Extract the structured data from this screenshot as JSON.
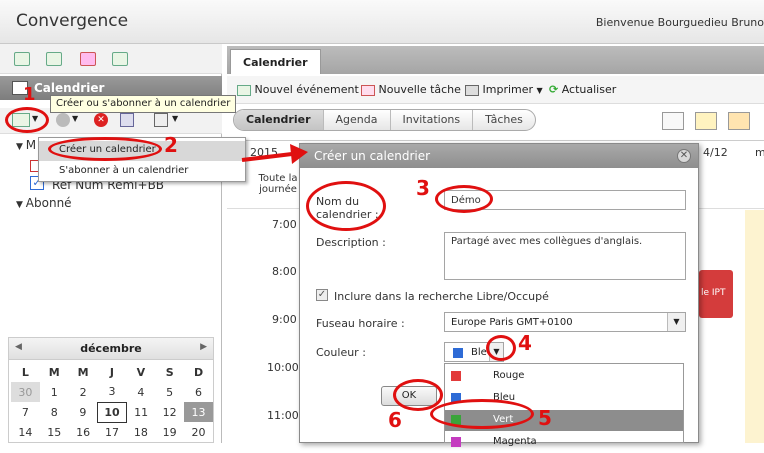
{
  "app": {
    "title": "Convergence",
    "welcome": "Bienvenue Bourguedieu Bruno"
  },
  "sidebar": {
    "calendar_header": "Calendrier",
    "tooltip": "Créer ou s'abonner à un calendrier",
    "menu": [
      "Créer un calendrier",
      "S'abonner à un calendrier"
    ],
    "tree": {
      "my_group": "M",
      "item": "Ref Num Remi+BB",
      "subscribed": "Abonné"
    }
  },
  "minical": {
    "month": "décembre",
    "weekdays": [
      "L",
      "M",
      "M",
      "J",
      "V",
      "S",
      "D"
    ],
    "weeks": [
      [
        "30",
        "1",
        "2",
        "3",
        "4",
        "5",
        "6"
      ],
      [
        "7",
        "8",
        "9",
        "10",
        "11",
        "12",
        "13"
      ],
      [
        "14",
        "15",
        "16",
        "17",
        "18",
        "19",
        "20"
      ]
    ],
    "today": "10",
    "selected": "13"
  },
  "main": {
    "tab": "Calendrier",
    "actions": {
      "new_event": "Nouvel événement",
      "new_task": "Nouvelle tâche",
      "print": "Imprimer",
      "refresh": "Actualiser"
    },
    "views": [
      "Calendrier",
      "Agenda",
      "Invitations",
      "Tâches"
    ],
    "year_partial": "2015",
    "allday": "Toute la journée",
    "date_col": "4/12",
    "date_col2": "m",
    "event_partial": "le IPT",
    "times": [
      "7:00",
      "8:00",
      "9:00",
      "10:00",
      "11:00"
    ]
  },
  "dialog": {
    "title": "Créer un calendrier",
    "name_label": "Nom du calendrier :",
    "name_value": "Démo",
    "desc_label": "Description :",
    "desc_value": "Partagé avec mes collègues d'anglais.",
    "freebusy_label": "Inclure dans la recherche Libre/Occupé",
    "tz_label": "Fuseau horaire :",
    "tz_value": "Europe Paris GMT+0100",
    "color_label": "Couleur :",
    "color_value": "Ble",
    "ok": "OK",
    "colors": [
      {
        "name": "Rouge",
        "hex": "#e23b3b"
      },
      {
        "name": "Bleu",
        "hex": "#2e6bd6"
      },
      {
        "name": "Vert",
        "hex": "#3aa43a"
      },
      {
        "name": "Magenta",
        "hex": "#c43bbf"
      }
    ]
  },
  "annotations": [
    "1",
    "2",
    "3",
    "4",
    "5",
    "6"
  ]
}
